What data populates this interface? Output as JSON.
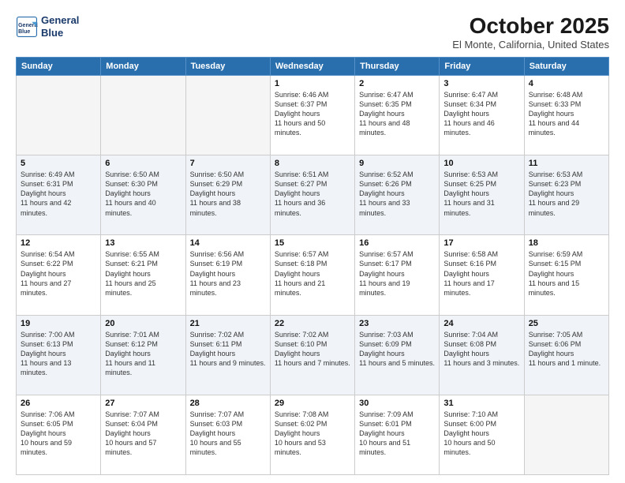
{
  "header": {
    "logo_line1": "General",
    "logo_line2": "Blue",
    "month": "October 2025",
    "location": "El Monte, California, United States"
  },
  "days_of_week": [
    "Sunday",
    "Monday",
    "Tuesday",
    "Wednesday",
    "Thursday",
    "Friday",
    "Saturday"
  ],
  "weeks": [
    [
      {
        "day": "",
        "empty": true
      },
      {
        "day": "",
        "empty": true
      },
      {
        "day": "",
        "empty": true
      },
      {
        "day": "1",
        "sunrise": "6:46 AM",
        "sunset": "6:37 PM",
        "daylight": "11 hours and 50 minutes."
      },
      {
        "day": "2",
        "sunrise": "6:47 AM",
        "sunset": "6:35 PM",
        "daylight": "11 hours and 48 minutes."
      },
      {
        "day": "3",
        "sunrise": "6:47 AM",
        "sunset": "6:34 PM",
        "daylight": "11 hours and 46 minutes."
      },
      {
        "day": "4",
        "sunrise": "6:48 AM",
        "sunset": "6:33 PM",
        "daylight": "11 hours and 44 minutes."
      }
    ],
    [
      {
        "day": "5",
        "sunrise": "6:49 AM",
        "sunset": "6:31 PM",
        "daylight": "11 hours and 42 minutes."
      },
      {
        "day": "6",
        "sunrise": "6:50 AM",
        "sunset": "6:30 PM",
        "daylight": "11 hours and 40 minutes."
      },
      {
        "day": "7",
        "sunrise": "6:50 AM",
        "sunset": "6:29 PM",
        "daylight": "11 hours and 38 minutes."
      },
      {
        "day": "8",
        "sunrise": "6:51 AM",
        "sunset": "6:27 PM",
        "daylight": "11 hours and 36 minutes."
      },
      {
        "day": "9",
        "sunrise": "6:52 AM",
        "sunset": "6:26 PM",
        "daylight": "11 hours and 33 minutes."
      },
      {
        "day": "10",
        "sunrise": "6:53 AM",
        "sunset": "6:25 PM",
        "daylight": "11 hours and 31 minutes."
      },
      {
        "day": "11",
        "sunrise": "6:53 AM",
        "sunset": "6:23 PM",
        "daylight": "11 hours and 29 minutes."
      }
    ],
    [
      {
        "day": "12",
        "sunrise": "6:54 AM",
        "sunset": "6:22 PM",
        "daylight": "11 hours and 27 minutes."
      },
      {
        "day": "13",
        "sunrise": "6:55 AM",
        "sunset": "6:21 PM",
        "daylight": "11 hours and 25 minutes."
      },
      {
        "day": "14",
        "sunrise": "6:56 AM",
        "sunset": "6:19 PM",
        "daylight": "11 hours and 23 minutes."
      },
      {
        "day": "15",
        "sunrise": "6:57 AM",
        "sunset": "6:18 PM",
        "daylight": "11 hours and 21 minutes."
      },
      {
        "day": "16",
        "sunrise": "6:57 AM",
        "sunset": "6:17 PM",
        "daylight": "11 hours and 19 minutes."
      },
      {
        "day": "17",
        "sunrise": "6:58 AM",
        "sunset": "6:16 PM",
        "daylight": "11 hours and 17 minutes."
      },
      {
        "day": "18",
        "sunrise": "6:59 AM",
        "sunset": "6:15 PM",
        "daylight": "11 hours and 15 minutes."
      }
    ],
    [
      {
        "day": "19",
        "sunrise": "7:00 AM",
        "sunset": "6:13 PM",
        "daylight": "11 hours and 13 minutes."
      },
      {
        "day": "20",
        "sunrise": "7:01 AM",
        "sunset": "6:12 PM",
        "daylight": "11 hours and 11 minutes."
      },
      {
        "day": "21",
        "sunrise": "7:02 AM",
        "sunset": "6:11 PM",
        "daylight": "11 hours and 9 minutes."
      },
      {
        "day": "22",
        "sunrise": "7:02 AM",
        "sunset": "6:10 PM",
        "daylight": "11 hours and 7 minutes."
      },
      {
        "day": "23",
        "sunrise": "7:03 AM",
        "sunset": "6:09 PM",
        "daylight": "11 hours and 5 minutes."
      },
      {
        "day": "24",
        "sunrise": "7:04 AM",
        "sunset": "6:08 PM",
        "daylight": "11 hours and 3 minutes."
      },
      {
        "day": "25",
        "sunrise": "7:05 AM",
        "sunset": "6:06 PM",
        "daylight": "11 hours and 1 minute."
      }
    ],
    [
      {
        "day": "26",
        "sunrise": "7:06 AM",
        "sunset": "6:05 PM",
        "daylight": "10 hours and 59 minutes."
      },
      {
        "day": "27",
        "sunrise": "7:07 AM",
        "sunset": "6:04 PM",
        "daylight": "10 hours and 57 minutes."
      },
      {
        "day": "28",
        "sunrise": "7:07 AM",
        "sunset": "6:03 PM",
        "daylight": "10 hours and 55 minutes."
      },
      {
        "day": "29",
        "sunrise": "7:08 AM",
        "sunset": "6:02 PM",
        "daylight": "10 hours and 53 minutes."
      },
      {
        "day": "30",
        "sunrise": "7:09 AM",
        "sunset": "6:01 PM",
        "daylight": "10 hours and 51 minutes."
      },
      {
        "day": "31",
        "sunrise": "7:10 AM",
        "sunset": "6:00 PM",
        "daylight": "10 hours and 50 minutes."
      },
      {
        "day": "",
        "empty": true
      }
    ]
  ]
}
